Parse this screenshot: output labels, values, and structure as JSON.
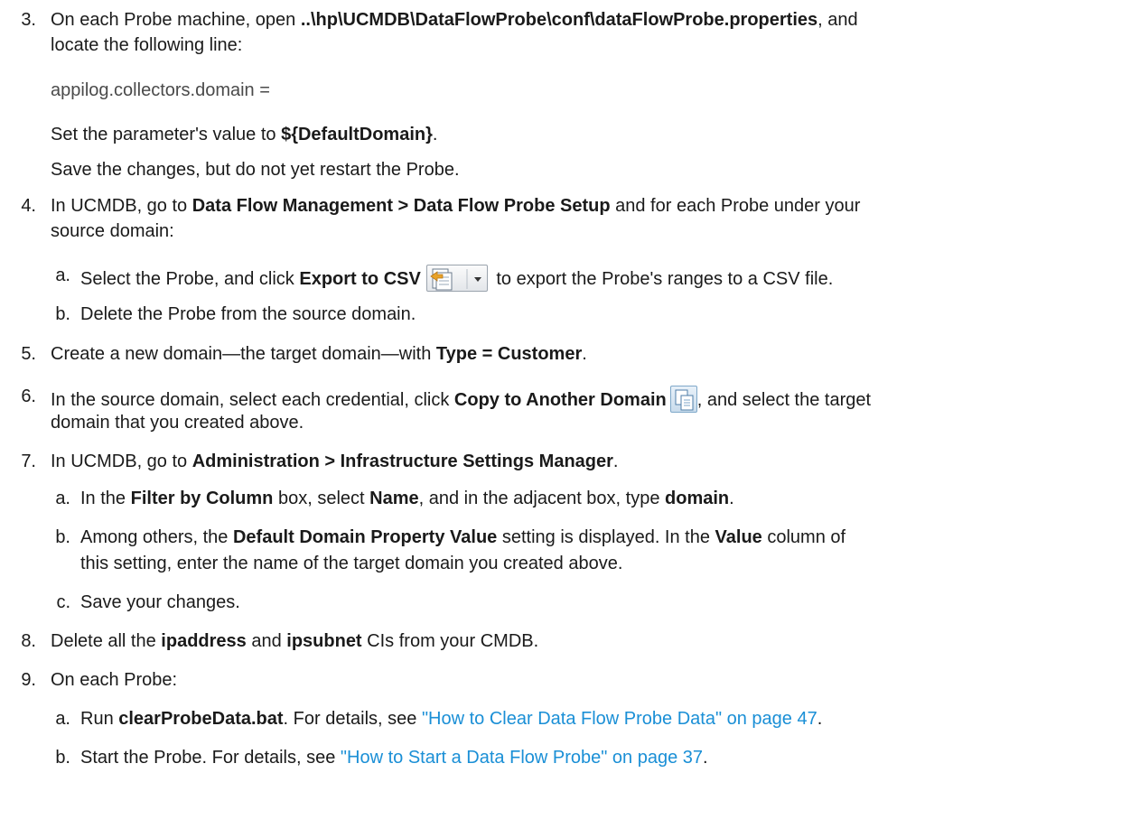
{
  "steps": {
    "s3": {
      "num": "3.",
      "l1_a": "On each Probe machine, open ",
      "l1_b": "..\\hp\\UCMDB\\DataFlowProbe\\conf\\dataFlowProbe.properties",
      "l1_c": ", and",
      "l2": "locate the following line:",
      "code": "appilog.collectors.domain =",
      "set_a": "Set the parameter's value to ",
      "set_b": "${DefaultDomain}",
      "set_c": ".",
      "save": "Save the changes, but do not yet restart the Probe."
    },
    "s4": {
      "num": "4.",
      "l1_a": "In UCMDB, go to ",
      "l1_b": "Data Flow Management > Data Flow Probe Setup",
      "l1_c": " and for each Probe under your",
      "l2": "source domain:",
      "a_num": "a.",
      "a_1": "Select the Probe, and click ",
      "a_2": "Export to CSV",
      "a_3": " to export the Probe's ranges to a CSV file.",
      "b_num": "b.",
      "b_text": "Delete the Probe from the source domain."
    },
    "s5": {
      "num": "5.",
      "a": "Create a new domain—the target domain—with ",
      "b": "Type = Customer",
      "c": "."
    },
    "s6": {
      "num": "6.",
      "a": "In the source domain, select each credential, click ",
      "b": "Copy to Another Domain",
      "c": ", and select the target",
      "l2": "domain that you created above."
    },
    "s7": {
      "num": "7.",
      "a": "In UCMDB, go to ",
      "b": "Administration > Infrastructure Settings Manager",
      "c": ".",
      "a_num": "a.",
      "a_1": "In the ",
      "a_2": "Filter by Column",
      "a_3": " box, select ",
      "a_4": "Name",
      "a_5": ", and in the adjacent box, type ",
      "a_6": "domain",
      "a_7": ".",
      "b_num": "b.",
      "b_1": "Among others, the ",
      "b_2": "Default Domain Property Value",
      "b_3": " setting is displayed. In the ",
      "b_4": "Value",
      "b_5": " column of",
      "b_l2": "this setting, enter the name of the target domain you created above.",
      "c_num": "c.",
      "c_text": "Save your changes."
    },
    "s8": {
      "num": "8.",
      "a": "Delete all the ",
      "b": "ipaddress",
      "c": " and ",
      "d": "ipsubnet",
      "e": " CIs from your CMDB."
    },
    "s9": {
      "num": "9.",
      "text": "On each Probe:",
      "a_num": "a.",
      "a_1": "Run ",
      "a_2": "clearProbeData.bat",
      "a_3": ". For details, see ",
      "a_link": "\"How to Clear Data Flow Probe Data\" on page 47",
      "a_4": ".",
      "b_num": "b.",
      "b_1": "Start the Probe. For details, see ",
      "b_link": "\"How to Start a Data Flow Probe\" on page 37",
      "b_2": "."
    }
  },
  "icons": {
    "export": "export-to-csv-icon",
    "copy": "copy-to-another-domain-icon"
  },
  "colors": {
    "text": "#1a1a1a",
    "link": "#1a8fd6",
    "code": "#4a4a4a"
  }
}
